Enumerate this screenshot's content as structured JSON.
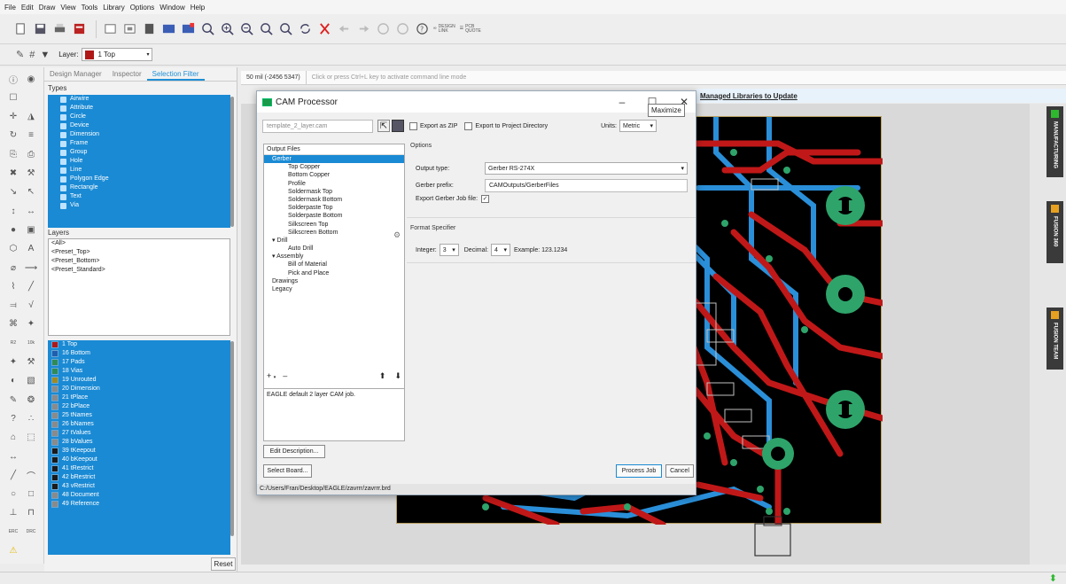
{
  "menu": [
    "File",
    "Edit",
    "Draw",
    "View",
    "Tools",
    "Library",
    "Options",
    "Window",
    "Help"
  ],
  "toolbar": {
    "design_link": "DESIGN LINK",
    "pcb_quote": "PCB QUOTE"
  },
  "layerbar": {
    "label": "Layer:",
    "value": "1 Top",
    "color": "#b01818"
  },
  "panel": {
    "tabs": [
      "Design Manager",
      "Inspector",
      "Selection Filter"
    ],
    "types_header": "Types",
    "types": [
      "Airwire",
      "Attribute",
      "Circle",
      "Device",
      "Dimension",
      "Frame",
      "Group",
      "Hole",
      "Line",
      "Polygon Edge",
      "Rectangle",
      "Text",
      "Via"
    ],
    "layers_header": "Layers",
    "presets": [
      "<All>",
      "<Preset_Top>",
      "<Preset_Bottom>",
      "<Preset_Standard>"
    ],
    "layers": [
      {
        "name": "1 Top",
        "color": "#b01818"
      },
      {
        "name": "16 Bottom",
        "color": "#1f5fb0"
      },
      {
        "name": "17 Pads",
        "color": "#2e8b57"
      },
      {
        "name": "18 Vias",
        "color": "#2e8b57"
      },
      {
        "name": "19 Unrouted",
        "color": "#a08a20"
      },
      {
        "name": "20 Dimension",
        "color": "#8a8a8a"
      },
      {
        "name": "21 tPlace",
        "color": "#8a8a8a"
      },
      {
        "name": "22 bPlace",
        "color": "#8a8a8a"
      },
      {
        "name": "25 tNames",
        "color": "#8a8a8a"
      },
      {
        "name": "26 bNames",
        "color": "#8a8a8a"
      },
      {
        "name": "27 tValues",
        "color": "#8a8a8a"
      },
      {
        "name": "28 bValues",
        "color": "#8a8a8a"
      },
      {
        "name": "39 tKeepout",
        "color": "#1a1a1a"
      },
      {
        "name": "40 bKeepout",
        "color": "#1a1a1a"
      },
      {
        "name": "41 tRestrict",
        "color": "#1a1a1a"
      },
      {
        "name": "42 bRestrict",
        "color": "#1a1a1a"
      },
      {
        "name": "43 vRestrict",
        "color": "#1a1a1a"
      },
      {
        "name": "48 Document",
        "color": "#8a8a8a"
      },
      {
        "name": "49 Reference",
        "color": "#8a8a8a"
      }
    ],
    "reset_label": "Reset"
  },
  "cmdbar": {
    "coord": "50 mil (-2456 5347)",
    "hint": "Click or press Ctrl+L key to activate command line mode"
  },
  "notice": "Managed Libraries to Update",
  "right_tabs": [
    {
      "label": "MANUFACTURING",
      "color": "#2eb82e",
      "glyph": "⚙"
    },
    {
      "label": "FUSION 360",
      "color": "#e8a020",
      "glyph": "F"
    },
    {
      "label": "FUSION TEAM",
      "color": "#e8a020",
      "glyph": "F"
    }
  ],
  "dialog": {
    "title": "CAM Processor",
    "tooltip": "Maximize",
    "cam_file": "template_2_layer.cam",
    "export_zip": "Export as ZIP",
    "export_project": "Export to Project Directory",
    "units_label": "Units:",
    "units_value": "Metric",
    "output_files_header": "Output Files",
    "tree": [
      {
        "label": "Gerber",
        "indent": 1,
        "selected": true
      },
      {
        "label": "Top Copper",
        "indent": 3
      },
      {
        "label": "Bottom Copper",
        "indent": 3
      },
      {
        "label": "Profile",
        "indent": 3
      },
      {
        "label": "Soldermask Top",
        "indent": 3
      },
      {
        "label": "Soldermask Bottom",
        "indent": 3
      },
      {
        "label": "Solderpaste Top",
        "indent": 3
      },
      {
        "label": "Solderpaste Bottom",
        "indent": 3
      },
      {
        "label": "Silkscreen Top",
        "indent": 3
      },
      {
        "label": "Silkscreen Bottom",
        "indent": 3
      },
      {
        "label": "▾  Drill",
        "indent": 1
      },
      {
        "label": "Auto Drill",
        "indent": 3
      },
      {
        "label": "▾  Assembly",
        "indent": 1
      },
      {
        "label": "Bill of Material",
        "indent": 3
      },
      {
        "label": "Pick and Place",
        "indent": 3
      },
      {
        "label": "Drawings",
        "indent": 1
      },
      {
        "label": "Legacy",
        "indent": 1
      }
    ],
    "description": "EAGLE default 2 layer CAM job.",
    "edit_description": "Edit Description...",
    "select_board": "Select Board...",
    "process_job": "Process Job",
    "cancel": "Cancel",
    "options_header": "Options",
    "output_type_label": "Output type:",
    "output_type_value": "Gerber RS-274X",
    "gerber_prefix_label": "Gerber prefix:",
    "gerber_prefix_value": "CAMOutputs/GerberFiles",
    "export_job_label": "Export Gerber Job file:",
    "format_header": "Format Specifier",
    "integer_label": "Integer:",
    "integer_value": "3",
    "decimal_label": "Decimal:",
    "decimal_value": "4",
    "example": "Example: 123.1234",
    "path": "C:/Users/Fran/Desktop/EAGLE/zavrrr/zavrrr.brd"
  },
  "colors": {
    "accent": "#1a8ad4",
    "trace_top": "#c01818",
    "trace_bottom": "#2a8fd8",
    "pad": "#2ea46a"
  }
}
